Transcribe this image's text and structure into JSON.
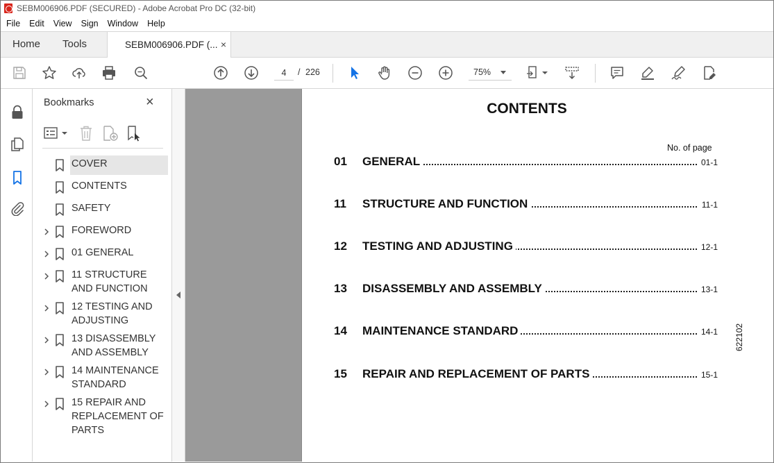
{
  "window": {
    "title": "SEBM006906.PDF (SECURED) - Adobe Acrobat Pro DC (32-bit)"
  },
  "menu": [
    "File",
    "Edit",
    "View",
    "Sign",
    "Window",
    "Help"
  ],
  "tabs": {
    "home": "Home",
    "tools": "Tools",
    "document": "SEBM006906.PDF (...",
    "close_glyph": "×"
  },
  "toolbar": {
    "page_current": "4",
    "page_separator": "/",
    "page_total": "226",
    "zoom": "75%",
    "icons": [
      "save-icon",
      "bookmark-star-icon",
      "upload-icon",
      "print-icon",
      "zoom-search-icon",
      "prev-page-icon",
      "next-page-icon",
      "select-cursor-icon",
      "hand-icon",
      "zoom-out-icon",
      "zoom-in-icon",
      "page-fit-icon",
      "scroll-mode-icon",
      "comment-icon",
      "highlight-icon",
      "sign-icon",
      "fill-sign-icon"
    ]
  },
  "bookmarks": {
    "header": "Bookmarks",
    "close_glyph": "×",
    "items": [
      {
        "label": "COVER",
        "expandable": false,
        "selected": true
      },
      {
        "label": "CONTENTS",
        "expandable": false,
        "selected": false
      },
      {
        "label": "SAFETY",
        "expandable": false,
        "selected": false
      },
      {
        "label": "FOREWORD",
        "expandable": true,
        "selected": false
      },
      {
        "label": "01 GENERAL",
        "expandable": true,
        "selected": false
      },
      {
        "label": "11 STRUCTURE AND FUNCTION",
        "expandable": true,
        "selected": false
      },
      {
        "label": "12 TESTING AND ADJUSTING",
        "expandable": true,
        "selected": false
      },
      {
        "label": "13 DISASSEMBLY AND ASSEMBLY",
        "expandable": true,
        "selected": false
      },
      {
        "label": "14 MAINTENANCE STANDARD",
        "expandable": true,
        "selected": false
      },
      {
        "label": "15 REPAIR AND REPLACEMENT OF PARTS",
        "expandable": true,
        "selected": false
      }
    ]
  },
  "document": {
    "title": "CONTENTS",
    "no_of_page_label": "No. of page",
    "toc": [
      {
        "num": "01",
        "title": "GENERAL",
        "page": "01-1"
      },
      {
        "num": "11",
        "title": "STRUCTURE AND FUNCTION",
        "page": "11-1"
      },
      {
        "num": "12",
        "title": "TESTING AND ADJUSTING",
        "page": "12-1"
      },
      {
        "num": "13",
        "title": "DISASSEMBLY AND ASSEMBLY",
        "page": "13-1"
      },
      {
        "num": "14",
        "title": "MAINTENANCE STANDARD",
        "page": "14-1"
      },
      {
        "num": "15",
        "title": "REPAIR AND REPLACEMENT OF PARTS",
        "page": "15-1"
      }
    ],
    "side_code": "622102"
  },
  "colors": {
    "accent": "#1473e6",
    "pdf_icon": "#d9261c",
    "gray_margin": "#9a9a9a"
  }
}
